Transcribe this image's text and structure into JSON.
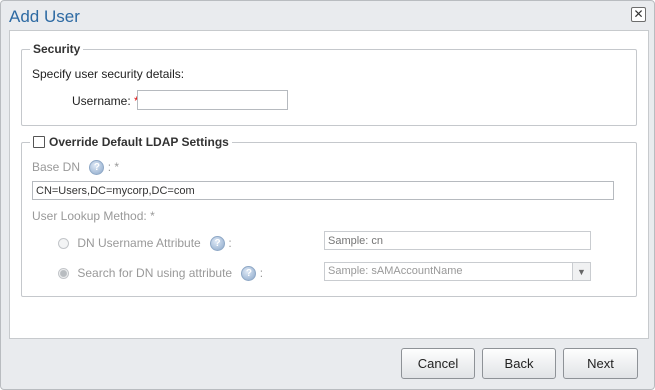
{
  "dialog": {
    "title": "Add User"
  },
  "security": {
    "legend": "Security",
    "instructions": "Specify user security details:",
    "username_label": "Username:",
    "required_mark": "*",
    "username_value": ""
  },
  "ldap": {
    "legend": "Override Default LDAP Settings",
    "override_checked": false,
    "base_dn_label": "Base DN",
    "base_dn_suffix": ":",
    "base_dn_value": "CN=Users,DC=mycorp,DC=com",
    "lookup_label": "User Lookup Method:",
    "options": [
      {
        "label": "DN Username Attribute",
        "suffix": ":",
        "placeholder": "Sample: cn",
        "selected": false
      },
      {
        "label": "Search for DN using attribute",
        "suffix": ":",
        "placeholder": "Sample: sAMAccountName",
        "selected": true
      }
    ]
  },
  "buttons": {
    "cancel": "Cancel",
    "back": "Back",
    "next": "Next"
  },
  "icons": {
    "close": "close-icon",
    "help": "help-icon",
    "dropdown": "chevron-down-icon"
  },
  "colors": {
    "title": "#2d6aa3",
    "required": "#dd1111",
    "disabled_text": "#999999"
  }
}
